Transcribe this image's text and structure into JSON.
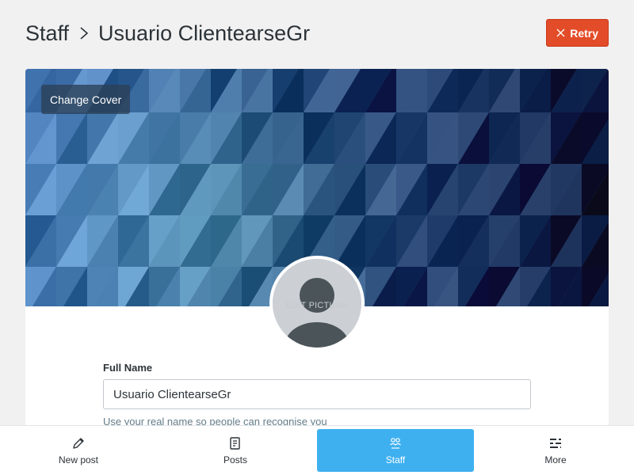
{
  "header": {
    "breadcrumb_parent": "Staff",
    "title": "Usuario ClientearseGr",
    "retry_label": "Retry"
  },
  "cover": {
    "change_cover_label": "Change Cover"
  },
  "avatar": {
    "edit_label": "EDIT PICTURE"
  },
  "form": {
    "full_name_label": "Full Name",
    "full_name_value": "Usuario ClientearseGr",
    "full_name_help": "Use your real name so people can recognise you"
  },
  "bottom_nav": {
    "items": [
      {
        "label": "New post",
        "icon": "pencil-icon"
      },
      {
        "label": "Posts",
        "icon": "posts-icon"
      },
      {
        "label": "Staff",
        "icon": "people-icon",
        "active": true
      },
      {
        "label": "More",
        "icon": "more-icon"
      }
    ]
  },
  "colors": {
    "retry_bg": "#e34c28",
    "active_nav": "#3eb0f0",
    "cover_base": "#3b6a9c"
  }
}
